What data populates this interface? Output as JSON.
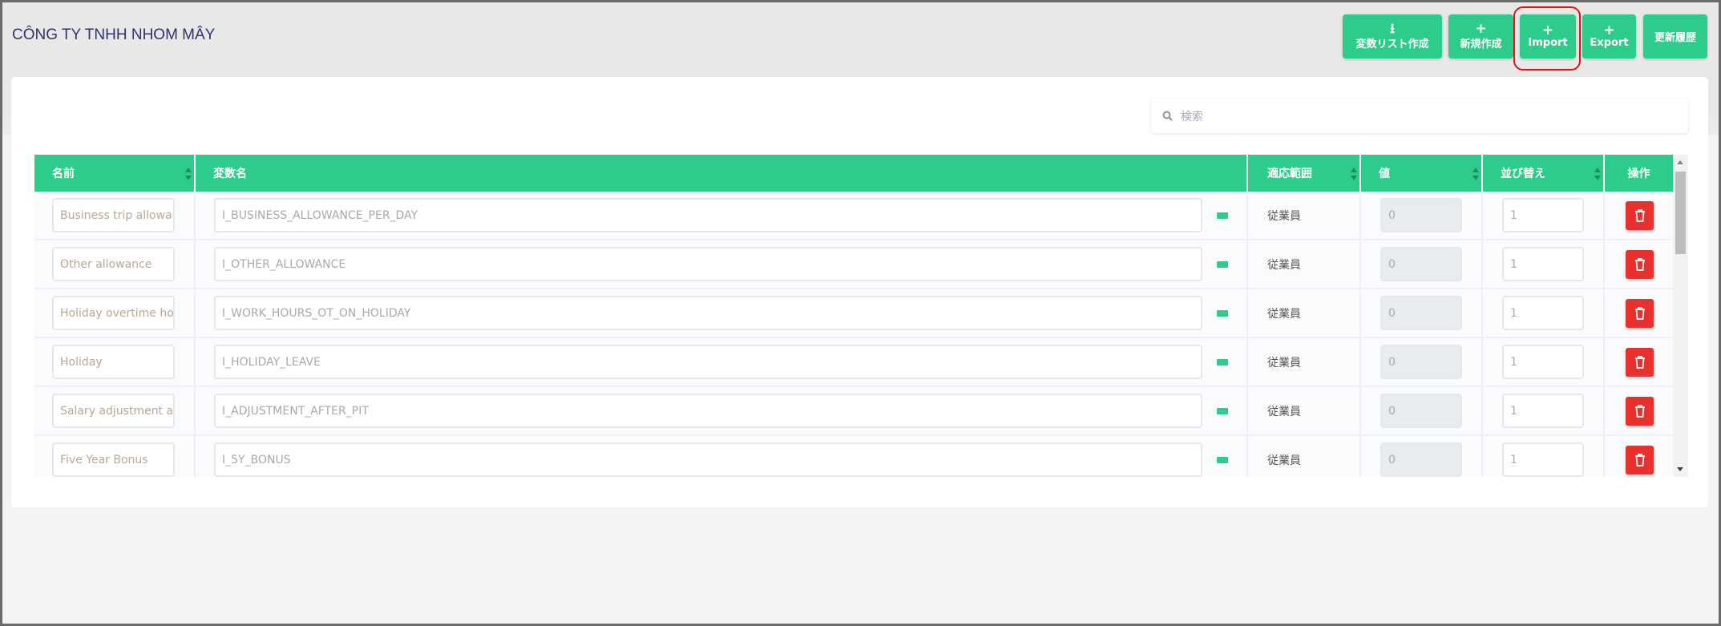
{
  "header": {
    "company": "CÔNG TY TNHH NHOM MÂY"
  },
  "toolbar": [
    {
      "label": "変数リスト作成",
      "icon": "download-icon"
    },
    {
      "label": "新規作成",
      "icon": "plus-icon"
    },
    {
      "label": "Import",
      "icon": "plus-icon",
      "highlighted": true
    },
    {
      "label": "Export",
      "icon": "plus-icon"
    },
    {
      "label": "更新履歴",
      "icon": ""
    }
  ],
  "search": {
    "placeholder": "検索"
  },
  "table": {
    "columns": [
      "名前",
      "変数名",
      "適応範囲",
      "値",
      "並び替え",
      "操作"
    ],
    "rows": [
      {
        "name": "Business trip allowance",
        "var": "I_BUSINESS_ALLOWANCE_PER_DAY",
        "scope": "従業員",
        "value": "0",
        "order": "1"
      },
      {
        "name": "Other allowance",
        "var": "I_OTHER_ALLOWANCE",
        "scope": "従業員",
        "value": "0",
        "order": "1"
      },
      {
        "name": "Holiday overtime hours",
        "var": "I_WORK_HOURS_OT_ON_HOLIDAY",
        "scope": "従業員",
        "value": "0",
        "order": "1"
      },
      {
        "name": "Holiday",
        "var": "I_HOLIDAY_LEAVE",
        "scope": "従業員",
        "value": "0",
        "order": "1"
      },
      {
        "name": "Salary adjustment after PIT",
        "var": "I_ADJUSTMENT_AFTER_PIT",
        "scope": "従業員",
        "value": "0",
        "order": "1"
      },
      {
        "name": "Five Year Bonus",
        "var": "I_5Y_BONUS",
        "scope": "従業員",
        "value": "0",
        "order": "1"
      }
    ]
  },
  "colors": {
    "primary": "#2ecc8a",
    "danger": "#e8302f",
    "highlight": "#e0101a"
  }
}
